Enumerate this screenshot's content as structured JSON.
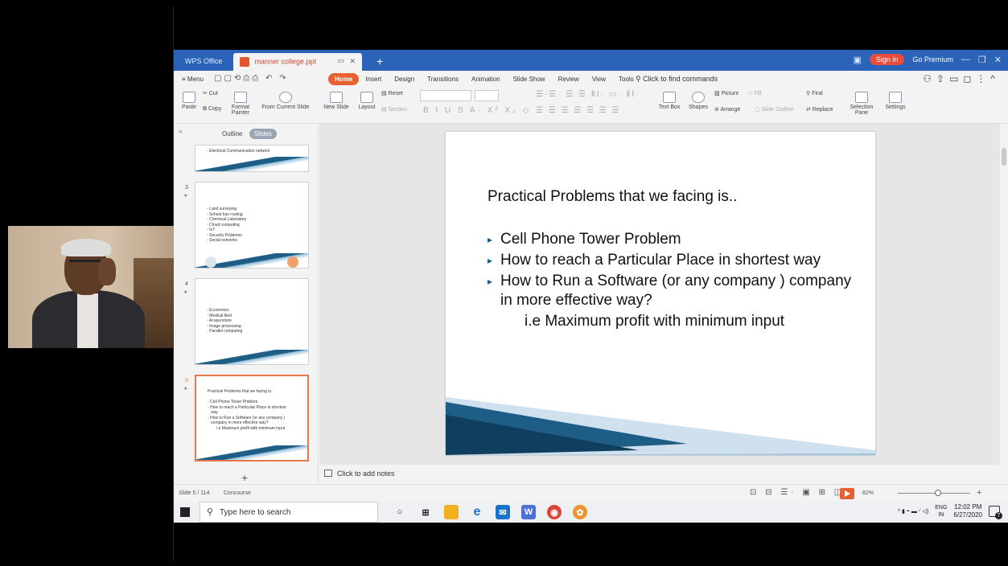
{
  "titlebar": {
    "wps_label": "WPS Office",
    "doc_tab": "manner college.ppt",
    "sign_in": "Sign in",
    "go_premium": "Go Premium"
  },
  "menubar": {
    "menu_label": "≡ Menu",
    "tabs": [
      "Home",
      "Insert",
      "Design",
      "Transitions",
      "Animation",
      "Slide Show",
      "Review",
      "View",
      "Tools"
    ],
    "find_commands": "Click to find commands"
  },
  "ribbon": {
    "paste": "Paste",
    "cut": "Cut",
    "copy": "Copy",
    "format_painter": "Format\nPainter",
    "from_current_slide": "From Current Slide",
    "new_slide": "New Slide",
    "layout": "Layout",
    "reset": "Reset",
    "section": "Section",
    "text_box": "Text Box",
    "shapes": "Shapes",
    "picture": "Picture",
    "fill": "Fill",
    "arrange": "Arrange",
    "slide_outline": "Slide Outline",
    "find": "Find",
    "replace": "Replace",
    "selection_pane": "Selection\nPane",
    "settings": "Settings"
  },
  "panel": {
    "collapse": "«",
    "tab_outline": "Outline",
    "tab_slides": "Slides",
    "thumbs": [
      {
        "num": "",
        "text": "◦ Electrical Communication network"
      },
      {
        "num": "3",
        "text": "◦ Land surveying\n◦ School bus routing\n◦ Chemical Laboratory\n◦ Cloud computing\n◦ IoT\n◦ Security Problems\n◦ Social networks"
      },
      {
        "num": "4",
        "text": "◦ Economics\n◦ Medical filed\n◦ Acupuncture\n◦ Image processing\n◦ Parallel computing"
      },
      {
        "num": "5",
        "text": "Practical Problems that we facing is..\n\n◦ Cell Phone Tower Problem\n◦ How to reach a Particular Place in shortest\n   way\n◦ How to Run a Software (or any company )\n   company in more effective way?\n        i.e Maximum profit with minimum input"
      }
    ],
    "add_slide": "+"
  },
  "slide": {
    "title": "Practical Problems that we facing is..",
    "bullets": [
      "Cell Phone Tower Problem",
      "How to reach a Particular Place in shortest way",
      "How to Run a Software (or any company ) company in more effective way?"
    ],
    "sub": "i.e Maximum profit with minimum input"
  },
  "notes": {
    "placeholder": "Click to add notes"
  },
  "statusbar": {
    "slide_counter": "Slide 5 / 114",
    "theme": "Concourse",
    "zoom": "82%"
  },
  "taskbar": {
    "search_placeholder": "Type here to search",
    "lang_top": "ENG",
    "lang_bottom": "IN",
    "time": "12:02 PM",
    "date": "6/27/2020",
    "notif_count": "7"
  },
  "colors": {
    "titlebar": "#2a63b8",
    "accent": "#e8602f",
    "slide_wedge": "#1d5d86"
  }
}
